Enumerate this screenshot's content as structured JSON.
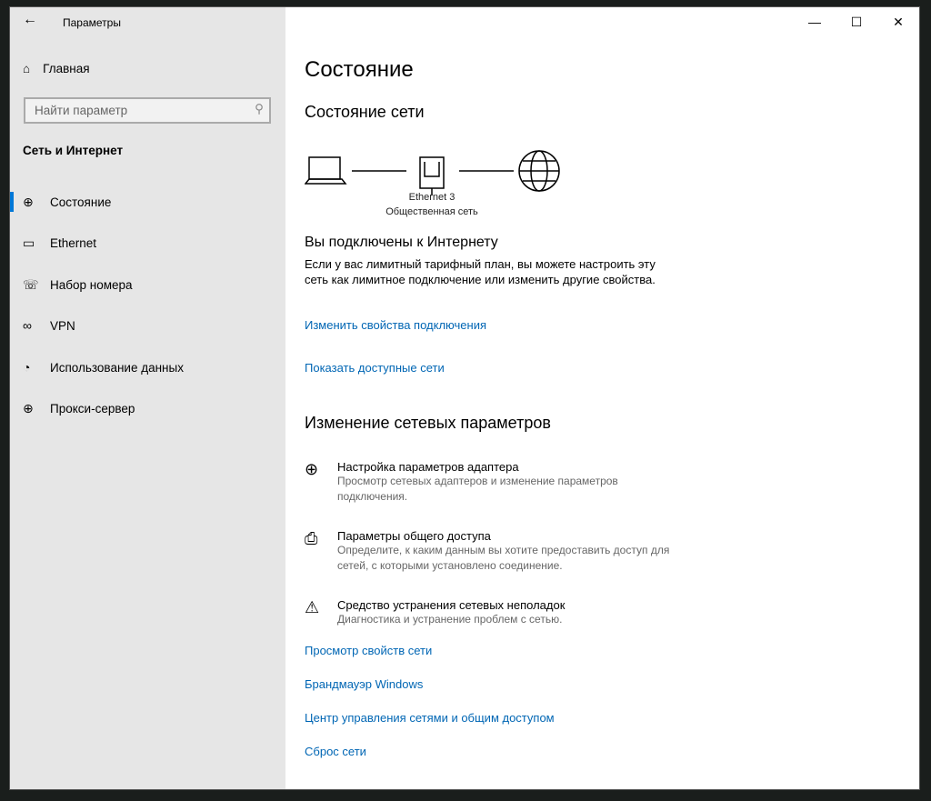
{
  "window": {
    "title": "Параметры",
    "minimize": "—",
    "maximize": "☐",
    "close": "✕"
  },
  "sidebar": {
    "home": "Главная",
    "search_placeholder": "Найти параметр",
    "section": "Сеть и Интернет",
    "items": [
      {
        "label": "Состояние",
        "icon": "status-icon"
      },
      {
        "label": "Ethernet",
        "icon": "ethernet-icon"
      },
      {
        "label": "Набор номера",
        "icon": "dialup-icon"
      },
      {
        "label": "VPN",
        "icon": "vpn-icon"
      },
      {
        "label": "Использование данных",
        "icon": "data-usage-icon"
      },
      {
        "label": "Прокси-сервер",
        "icon": "globe-icon"
      }
    ]
  },
  "main": {
    "title": "Состояние",
    "network_status": "Состояние сети",
    "adapter_name": "Ethernet 3",
    "network_type": "Общественная сеть",
    "connected": "Вы подключены к Интернету",
    "connected_desc": "Если у вас лимитный тарифный план, вы можете настроить эту сеть как лимитное подключение или изменить другие свойства.",
    "link_change_props": "Изменить свойства подключения",
    "link_show_networks": "Показать доступные сети",
    "change_settings": "Изменение сетевых параметров",
    "options": [
      {
        "title": "Настройка параметров адаптера",
        "desc": "Просмотр сетевых адаптеров и изменение параметров подключения."
      },
      {
        "title": "Параметры общего доступа",
        "desc": "Определите, к каким данным вы хотите предоставить доступ для сетей, с которыми установлено соединение."
      },
      {
        "title": "Средство устранения сетевых неполадок",
        "desc": "Диагностика и устранение проблем с сетью."
      }
    ],
    "links": [
      "Просмотр свойств сети",
      "Брандмауэр Windows",
      "Центр управления сетями и общим доступом",
      "Сброс сети"
    ]
  },
  "colors": {
    "accent": "#0078d7",
    "link": "#0066b4",
    "sidebar": "#e6e6e6"
  }
}
